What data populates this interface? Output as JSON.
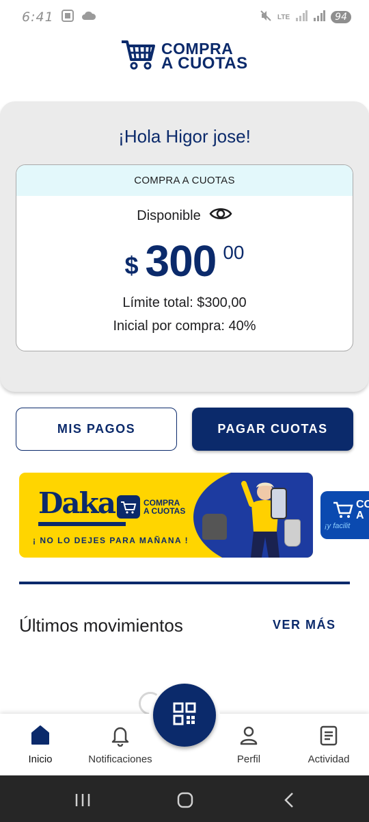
{
  "status_bar": {
    "time": "6:41",
    "network": "LTE",
    "battery": "94"
  },
  "logo": {
    "line1": "COMPRA",
    "line2": "A CUOTAS"
  },
  "greeting": "¡Hola Higor jose!",
  "credit_card": {
    "header": "COMPRA A CUOTAS",
    "available_label": "Disponible",
    "currency": "$",
    "amount_integer": "300",
    "amount_decimal": "00",
    "total_limit": "Límite total: $300,00",
    "initial_per_purchase": "Inicial por compra: 40%"
  },
  "actions": {
    "mis_pagos": "MIS PAGOS",
    "pagar_cuotas": "PAGAR CUOTAS"
  },
  "banner": {
    "brand": "Daka",
    "mini_logo_line1": "COMPRA",
    "mini_logo_line2": "A CUOTAS",
    "slogan": "¡ NO LO DEJES PARA MAÑANA !"
  },
  "banner2": {
    "text_line1": "CO",
    "text_line2": "A",
    "sub": "¡y facilit"
  },
  "movements": {
    "title": "Últimos movimientos",
    "see_more": "VER MÁS"
  },
  "bottom_nav": {
    "items": [
      {
        "label": "Inicio",
        "icon": "home-icon"
      },
      {
        "label": "Notificaciones",
        "icon": "bell-icon"
      },
      {
        "label": "Perfil",
        "icon": "person-icon"
      },
      {
        "label": "Actividad",
        "icon": "list-icon"
      }
    ],
    "fab_icon": "qr-code-icon"
  },
  "colors": {
    "brand_navy": "#0b2a6b",
    "card_bg": "#ebebeb",
    "header_tint": "#e3f8fb",
    "banner_yellow": "#ffd500"
  }
}
